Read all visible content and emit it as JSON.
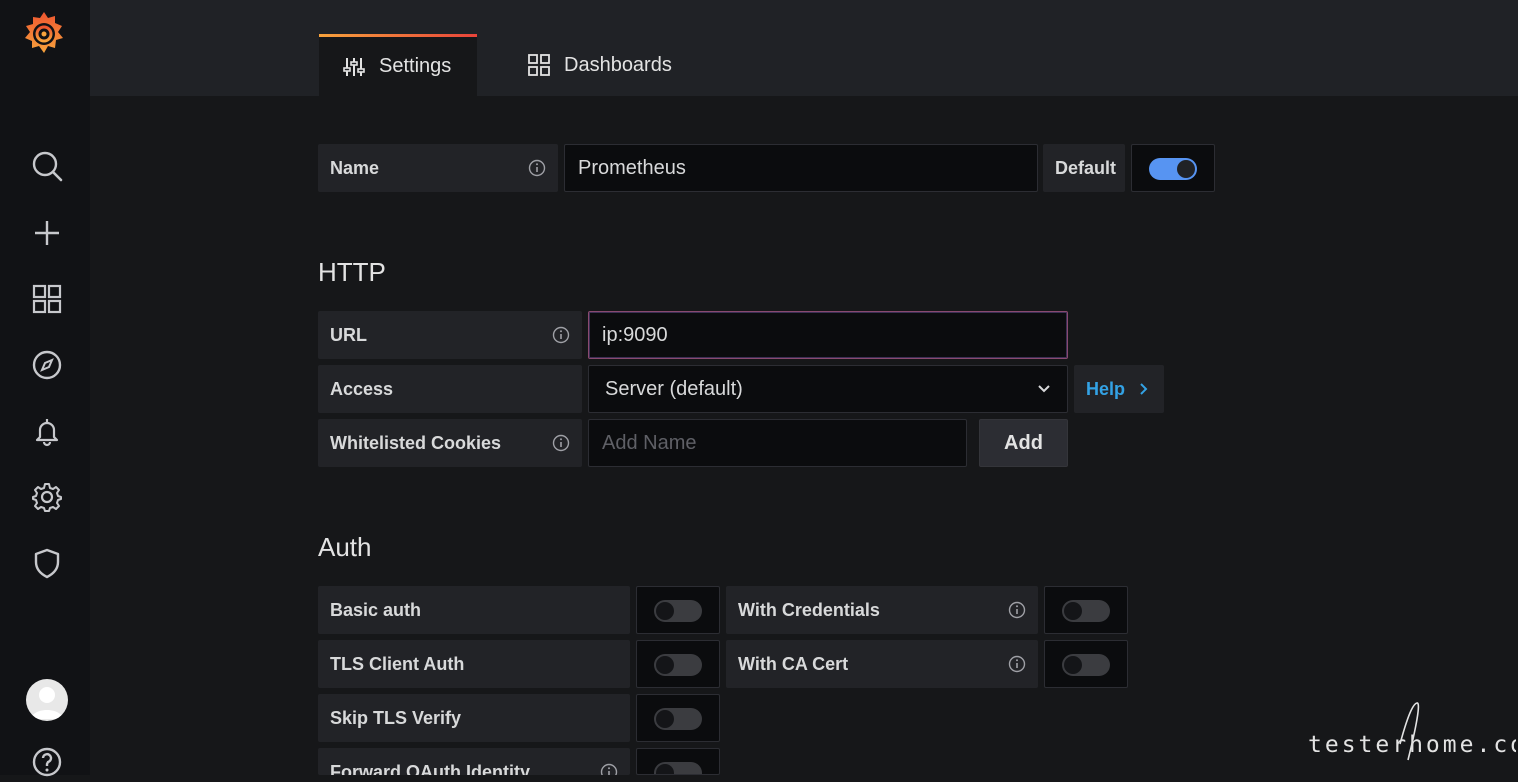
{
  "tabs": [
    {
      "label": "Settings",
      "active": true
    },
    {
      "label": "Dashboards",
      "active": false
    }
  ],
  "name_row": {
    "label": "Name",
    "value": "Prometheus",
    "default_label": "Default",
    "default_on": true
  },
  "http": {
    "title": "HTTP",
    "url_label": "URL",
    "url_value": "ip:9090",
    "access_label": "Access",
    "access_value": "Server (default)",
    "help_label": "Help",
    "cookies_label": "Whitelisted Cookies",
    "cookies_placeholder": "Add Name",
    "add_label": "Add"
  },
  "auth": {
    "title": "Auth",
    "basic_auth": {
      "label": "Basic auth",
      "on": false
    },
    "with_credentials": {
      "label": "With Credentials",
      "on": false
    },
    "tls_client_auth": {
      "label": "TLS Client Auth",
      "on": false
    },
    "with_ca_cert": {
      "label": "With CA Cert",
      "on": false
    },
    "skip_tls_verify": {
      "label": "Skip TLS Verify",
      "on": false
    },
    "forward_oauth": {
      "label": "Forward OAuth Identity",
      "on": false
    }
  },
  "watermark": "testerhome.com",
  "colors": {
    "accent_blue": "#5794f2",
    "link_blue": "#33a2e5",
    "brand_orange": "#f7a33c"
  },
  "icons": [
    "grafana-logo-icon",
    "search-icon",
    "plus-icon",
    "dashboards-icon",
    "explore-icon",
    "bell-icon",
    "gear-icon",
    "shield-icon",
    "avatar-icon",
    "help-icon"
  ]
}
